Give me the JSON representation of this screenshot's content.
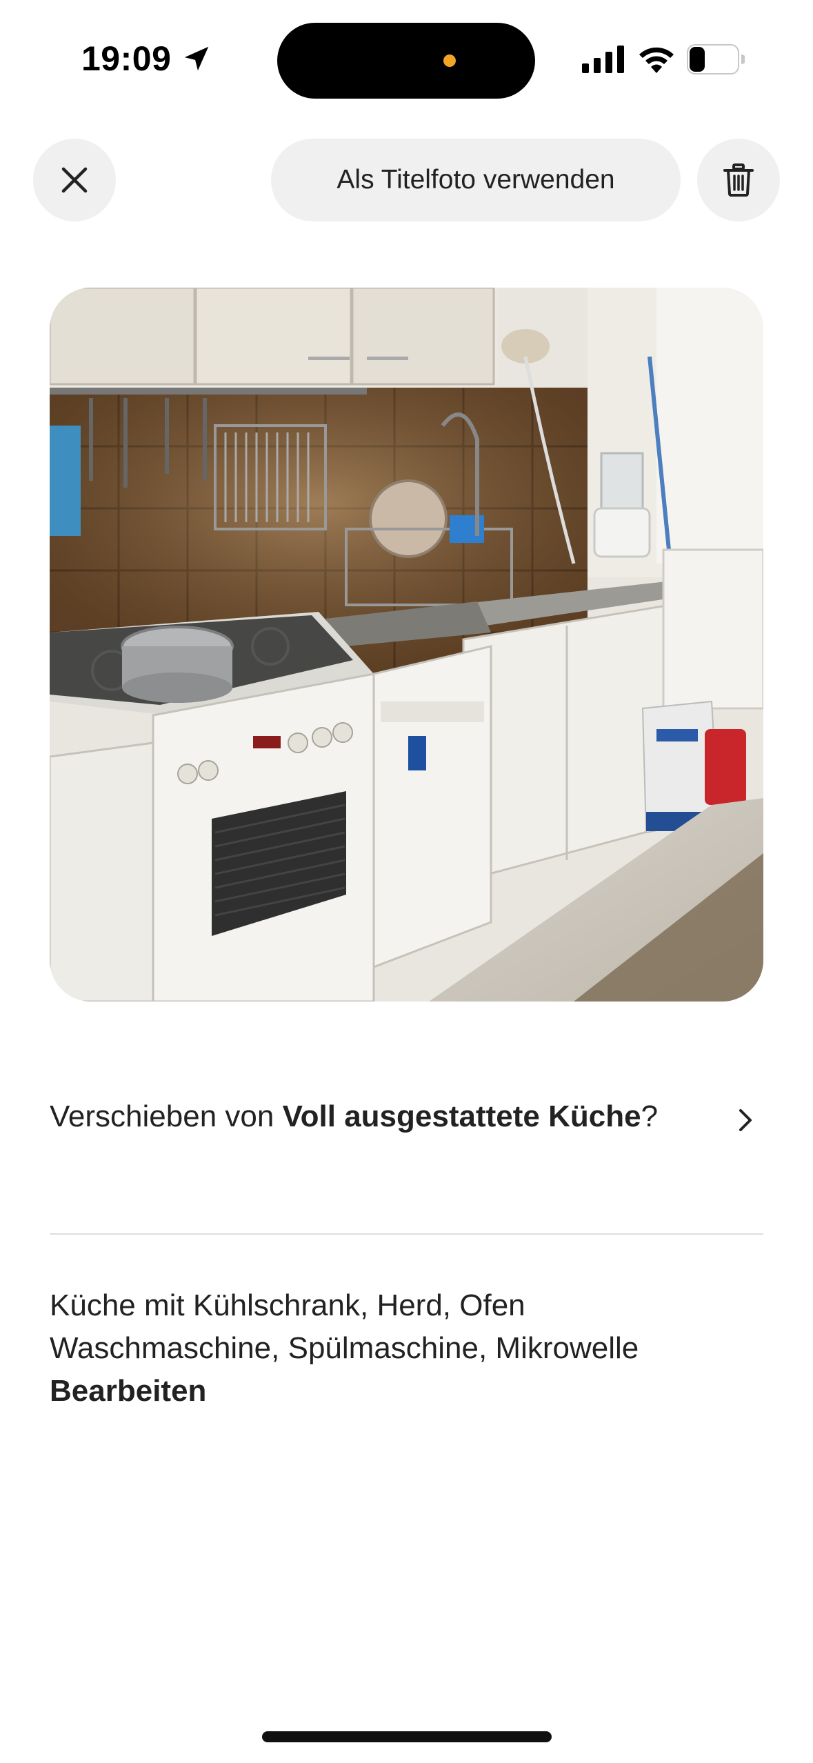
{
  "status_bar": {
    "time": "19:09",
    "battery": "25",
    "icons": [
      "location-arrow-icon",
      "signal-icon",
      "wifi-icon",
      "battery-icon"
    ]
  },
  "toolbar": {
    "close_icon": "close-icon",
    "cover_photo_label": "Als Titelfoto verwenden",
    "delete_icon": "trash-icon"
  },
  "photo": {
    "subject": "kitchen"
  },
  "move": {
    "prefix": "Verschieben von ",
    "room": "Voll ausgestattete Küche",
    "suffix": "?"
  },
  "caption": {
    "line1": "Küche mit Kühlschrank, Herd, Ofen",
    "line2": "Waschmaschine, Spülmaschine, Mikrowelle",
    "edit_label": "Bearbeiten"
  },
  "colors": {
    "button_bg": "#f0f0f0",
    "text": "#222222",
    "divider": "#dddddd",
    "island_indicator": "#f2a427"
  }
}
